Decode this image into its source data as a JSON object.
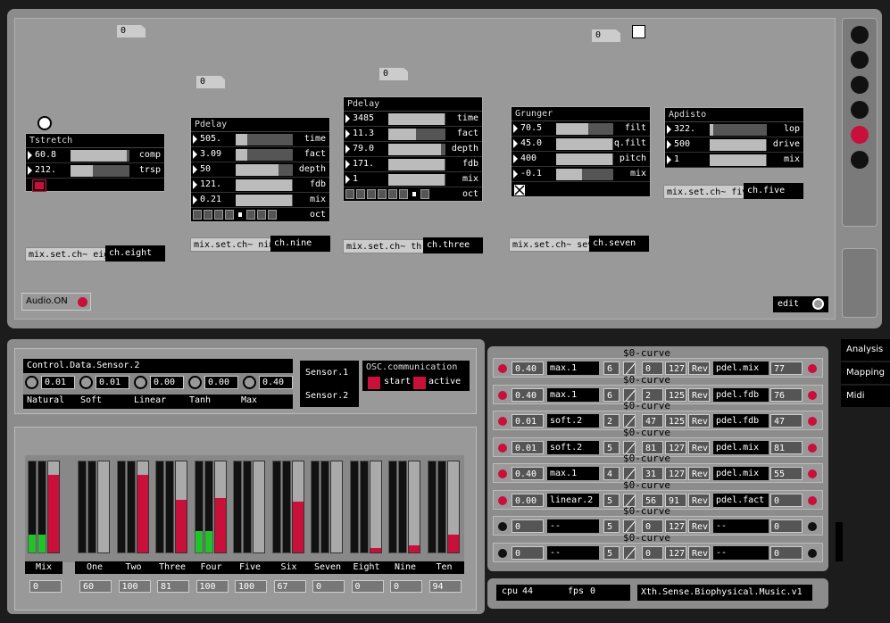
{
  "colors": {
    "accent": "#c8103a",
    "meter_green": "#22c22a",
    "panel": "#8c8c8c"
  },
  "top_numboxes": [
    "0",
    "0",
    "0",
    "0"
  ],
  "tstretch": {
    "title": "Tstretch",
    "rows": [
      {
        "value": "60.8",
        "label": "comp",
        "level": 0.95
      },
      {
        "value": "212.",
        "label": "trsp",
        "level": 0.38
      }
    ],
    "send": "mix.set.ch~ eig",
    "channel": "ch.eight"
  },
  "pdelay1": {
    "title": "Pdelay",
    "rows": [
      {
        "value": "505.",
        "label": "time",
        "level": 0.2
      },
      {
        "value": "3.09",
        "label": "fact",
        "level": 0.2
      },
      {
        "value": "50",
        "label": "depth",
        "level": 0.75
      },
      {
        "value": "121.",
        "label": "fdb",
        "level": 0.98
      },
      {
        "value": "0.21",
        "label": "mix",
        "level": 0.98
      }
    ],
    "oct_label": "oct",
    "oct_selected": 5,
    "send": "mix.set.ch~ nin",
    "channel": "ch.nine"
  },
  "pdelay2": {
    "title": "Pdelay",
    "rows": [
      {
        "value": "3485",
        "label": "time",
        "level": 0.98
      },
      {
        "value": "11.3",
        "label": "fact",
        "level": 0.48
      },
      {
        "value": "79.0",
        "label": "depth",
        "level": 0.92
      },
      {
        "value": "171.",
        "label": "fdb",
        "level": 0.98
      },
      {
        "value": "1",
        "label": "mix",
        "level": 0.98
      }
    ],
    "oct_label": "oct",
    "oct_selected": 7,
    "send": "mix.set.ch~ thr",
    "channel": "ch.three"
  },
  "grunger": {
    "title": "Grunger",
    "rows": [
      {
        "value": "70.5",
        "label": "filt",
        "level": 0.56
      },
      {
        "value": "45.0",
        "label": "q.filt",
        "level": 0.98
      },
      {
        "value": "400",
        "label": "pitch",
        "level": 0.98
      },
      {
        "value": "-0.1",
        "label": "mix",
        "level": 0.45
      }
    ],
    "send": "mix.set.ch~ sev",
    "channel": "ch.seven"
  },
  "apdisto": {
    "title": "Apdisto",
    "rows": [
      {
        "value": "322.",
        "label": "lop",
        "level": 0.06
      },
      {
        "value": "500",
        "label": "drive",
        "level": 0.98
      },
      {
        "value": "1",
        "label": "mix",
        "level": 0.98
      }
    ],
    "send": "mix.set.ch~ fiv",
    "channel": "ch.five"
  },
  "audio_label": "Audio.ON",
  "edit_label": "edit",
  "sensor": {
    "title": "Control.Data.Sensor.2",
    "values": [
      "0.01",
      "0.01",
      "0.00",
      "0.00",
      "0.40"
    ],
    "labels": [
      "Natural",
      "Soft",
      "Linear",
      "Tanh",
      "Max"
    ],
    "sensor1": "Sensor.1",
    "sensor2": "Sensor.2"
  },
  "osc": {
    "title": "OSC.communication",
    "start": "start",
    "active": "active"
  },
  "mixer": {
    "channels": [
      {
        "name": "Mix",
        "value": "0",
        "left": 0.2,
        "right": 0.2,
        "bar": 0.85
      },
      {
        "name": "One",
        "value": "60",
        "left": 0,
        "right": 0,
        "bar": 0.0
      },
      {
        "name": "Two",
        "value": "100",
        "left": 0,
        "right": 0,
        "bar": 0.85
      },
      {
        "name": "Three",
        "value": "81",
        "left": 0,
        "right": 0,
        "bar": 0.58
      },
      {
        "name": "Four",
        "value": "100",
        "left": 0.24,
        "right": 0.24,
        "bar": 0.6
      },
      {
        "name": "Five",
        "value": "100",
        "left": 0,
        "right": 0,
        "bar": 0.0
      },
      {
        "name": "Six",
        "value": "67",
        "left": 0,
        "right": 0,
        "bar": 0.56
      },
      {
        "name": "Seven",
        "value": "0",
        "left": 0,
        "right": 0,
        "bar": 0.0
      },
      {
        "name": "Eight",
        "value": "0",
        "left": 0,
        "right": 0,
        "bar": 0.05
      },
      {
        "name": "Nine",
        "value": "0",
        "left": 0,
        "right": 0,
        "bar": 0.08
      },
      {
        "name": "Ten",
        "value": "94",
        "left": 0,
        "right": 0,
        "bar": 0.2
      }
    ]
  },
  "mapping": {
    "curve_label": "$0-curve",
    "rev_label": "Rev",
    "rows": [
      {
        "active": true,
        "value": "0.40",
        "func": "max.1",
        "n": "6",
        "lo": "0",
        "hi": "127",
        "target": "pdel.mix",
        "out": "77"
      },
      {
        "active": true,
        "value": "0.40",
        "func": "max.1",
        "n": "6",
        "lo": "2",
        "hi": "125",
        "target": "pdel.fdb",
        "out": "76"
      },
      {
        "active": true,
        "value": "0.01",
        "func": "soft.2",
        "n": "2",
        "lo": "47",
        "hi": "125",
        "target": "pdel.fdb",
        "out": "47"
      },
      {
        "active": true,
        "value": "0.01",
        "func": "soft.2",
        "n": "5",
        "lo": "81",
        "hi": "127",
        "target": "pdel.mix",
        "out": "81"
      },
      {
        "active": true,
        "value": "0.40",
        "func": "max.1",
        "n": "4",
        "lo": "31",
        "hi": "127",
        "target": "pdel.mix",
        "out": "55"
      },
      {
        "active": true,
        "value": "0.00",
        "func": "linear.2",
        "n": "5",
        "lo": "56",
        "hi": "91",
        "target": "pdel.fact",
        "out": "0"
      },
      {
        "active": false,
        "value": "0",
        "func": "--",
        "n": "5",
        "lo": "0",
        "hi": "127",
        "target": "--",
        "out": "0"
      },
      {
        "active": false,
        "value": "0",
        "func": "--",
        "n": "5",
        "lo": "0",
        "hi": "127",
        "target": "--",
        "out": "0"
      }
    ]
  },
  "status": {
    "cpu_label": "cpu",
    "cpu": "44",
    "fps_label": "fps",
    "fps": "0",
    "title": "Xth.Sense.Biophysical.Music.v1"
  },
  "tabs": [
    "Analysis",
    "Mapping",
    "Midi"
  ]
}
